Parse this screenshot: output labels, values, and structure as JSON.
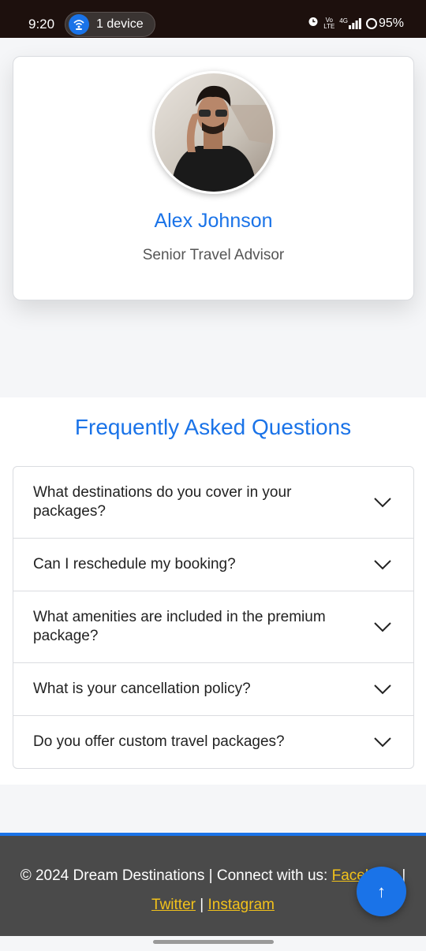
{
  "status_bar": {
    "time": "9:20",
    "device_pill": "1 device",
    "net_top": "Vo",
    "net_bottom": "LTE",
    "signal_label": "4G",
    "battery": "95%"
  },
  "profile": {
    "name": "Alex Johnson",
    "role": "Senior Travel Advisor"
  },
  "faq": {
    "title": "Frequently Asked Questions",
    "items": [
      {
        "question": "What destinations do you cover in your packages?"
      },
      {
        "question": "Can I reschedule my booking?"
      },
      {
        "question": "What amenities are included in the premium package?"
      },
      {
        "question": "What is your cancellation policy?"
      },
      {
        "question": "Do you offer custom travel packages?"
      }
    ]
  },
  "footer": {
    "text": "© 2024 Dream Destinations | Connect with us:",
    "links": [
      "Facebook",
      "Twitter",
      "Instagram"
    ],
    "separator": "|"
  },
  "fab": {
    "label": "↑"
  },
  "colors": {
    "accent": "#1a73e8",
    "link": "#f2c21b",
    "footer_bg": "#4a4a4a",
    "status_bg": "#1d100d"
  }
}
